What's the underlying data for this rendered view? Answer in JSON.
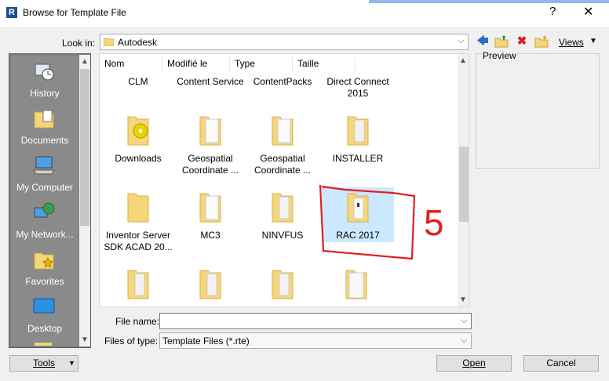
{
  "window": {
    "title": "Browse for Template File",
    "help_label": "?",
    "close_label": "✕"
  },
  "look_in": {
    "label": "Look in:",
    "value": "Autodesk",
    "views_label": "Views"
  },
  "places": [
    {
      "label": "History",
      "icon": "history-icon"
    },
    {
      "label": "Documents",
      "icon": "documents-icon"
    },
    {
      "label": "My Computer",
      "icon": "computer-icon"
    },
    {
      "label": "My Network...",
      "icon": "network-icon"
    },
    {
      "label": "Favorites",
      "icon": "favorites-icon"
    },
    {
      "label": "Desktop",
      "icon": "desktop-icon"
    }
  ],
  "columns": [
    "Nom",
    "Modifié le",
    "Type",
    "Taille"
  ],
  "items": [
    {
      "name": "CLM"
    },
    {
      "name": "Content Service"
    },
    {
      "name": "ContentPacks"
    },
    {
      "name": "Direct Connect 2015"
    },
    {
      "name": "Downloads"
    },
    {
      "name": "Geospatial Coordinate ..."
    },
    {
      "name": "Geospatial Coordinate ..."
    },
    {
      "name": "INSTALLER"
    },
    {
      "name": "Inventor Server SDK ACAD 20..."
    },
    {
      "name": "MC3"
    },
    {
      "name": "NINVFUS"
    },
    {
      "name": "RAC 2017"
    }
  ],
  "preview": {
    "label": "Preview"
  },
  "file_name": {
    "label": "File name:",
    "value": ""
  },
  "file_type": {
    "label": "Files of type:",
    "value": "Template Files  (*.rte)"
  },
  "buttons": {
    "tools": "Tools",
    "open": "Open",
    "cancel": "Cancel"
  },
  "annotation": {
    "text": "5",
    "color": "#e02020"
  },
  "colors": {
    "folder": "#f5d67a",
    "selection": "#cce8ff",
    "places_bg": "#8a8a8a"
  }
}
